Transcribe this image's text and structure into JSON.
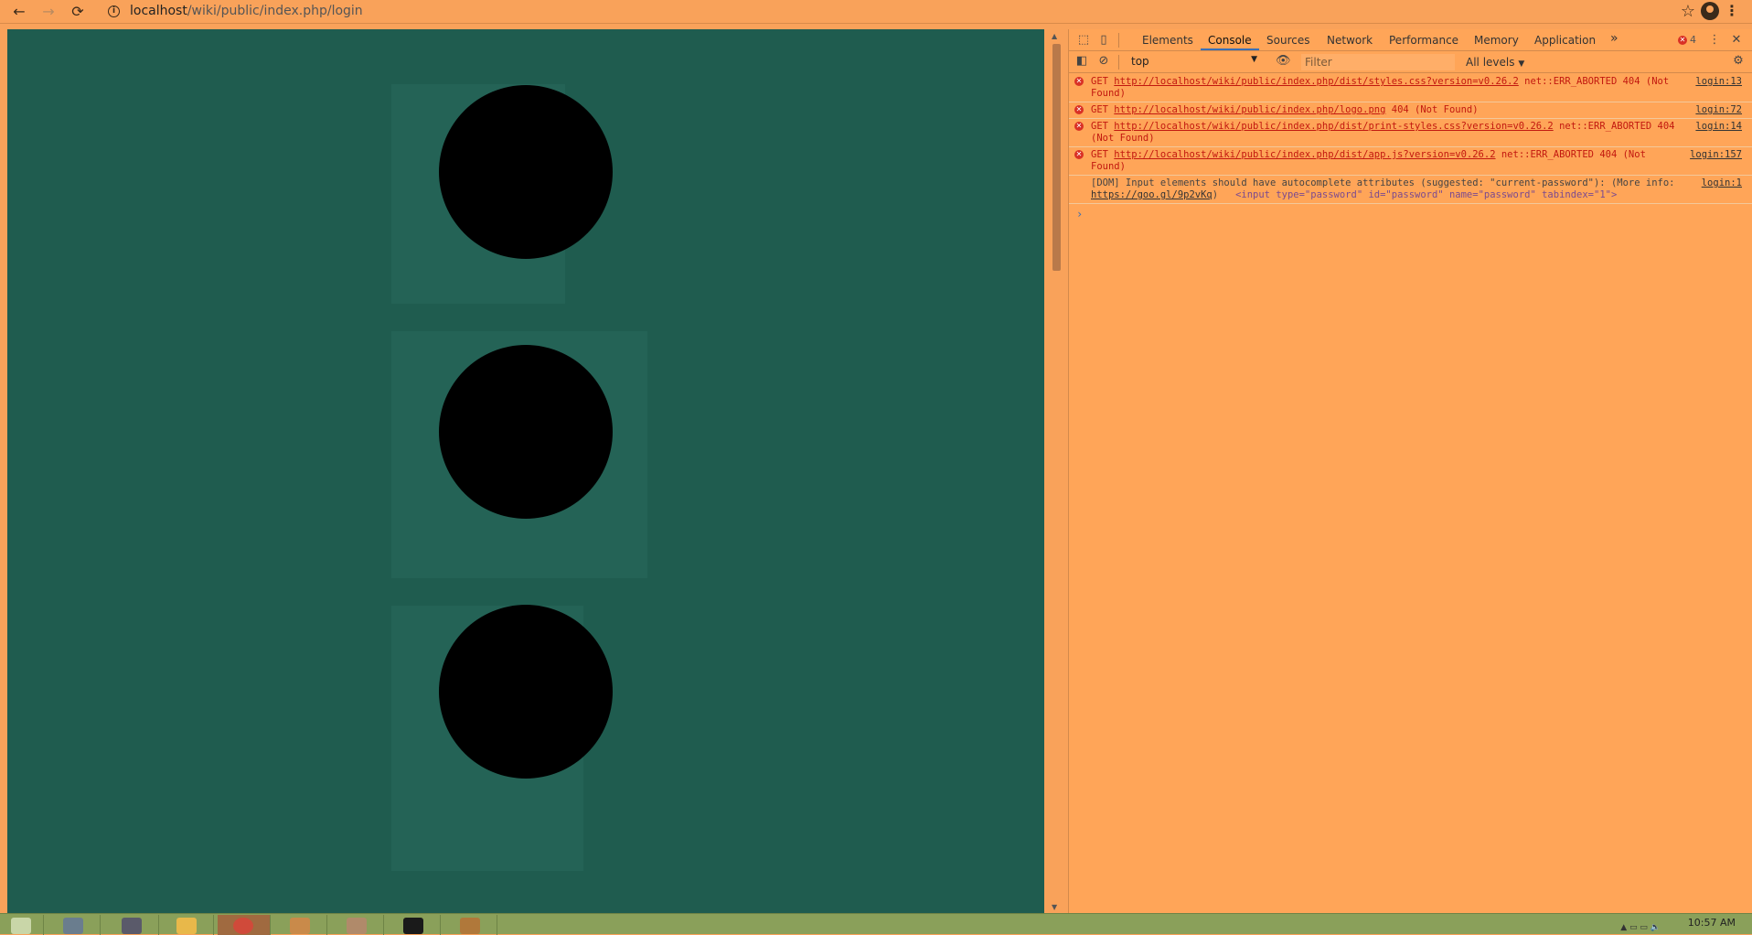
{
  "browser": {
    "url_host": "localhost",
    "url_path": "/wiki/public/index.php/login",
    "back_icon": "arrow-left-icon",
    "forward_icon": "arrow-right-icon",
    "reload_icon": "reload-icon"
  },
  "page": {
    "background": "#1f5c4f",
    "dot_color": "#000000",
    "dot_count": 3
  },
  "devtools": {
    "tabs": [
      "Elements",
      "Console",
      "Sources",
      "Network",
      "Performance",
      "Memory",
      "Application"
    ],
    "active_tab": "Console",
    "more_tabs": "»",
    "error_count": "4",
    "context": "top",
    "filter_placeholder": "Filter",
    "levels": "All levels",
    "messages": [
      {
        "level": "error",
        "method": "GET",
        "url": "http://localhost/wiki/public/index.php/dist/styles.css?version=v0.26.2",
        "tail": "net::ERR_ABORTED 404 (Not Found)",
        "source": "login:13"
      },
      {
        "level": "error",
        "method": "GET",
        "url": "http://localhost/wiki/public/index.php/logo.png",
        "tail": "404 (Not Found)",
        "source": "login:72"
      },
      {
        "level": "error",
        "method": "GET",
        "url": "http://localhost/wiki/public/index.php/dist/print-styles.css?version=v0.26.2",
        "tail": "net::ERR_ABORTED 404 (Not Found)",
        "source": "login:14"
      },
      {
        "level": "error",
        "method": "GET",
        "url": "http://localhost/wiki/public/index.php/dist/app.js?version=v0.26.2",
        "tail": "net::ERR_ABORTED 404 (Not Found)",
        "source": "login:157"
      },
      {
        "level": "info",
        "text": "[DOM] Input elements should have autocomplete attributes (suggested: \"current-password\"): (More info:",
        "link": "https://goo.gl/9p2vKq",
        "close": ")",
        "snippet": "<input type=\"password\" id=\"password\" name=\"password\" tabindex=\"1\">",
        "source": "login:1"
      }
    ],
    "prompt": "›"
  },
  "taskbar": {
    "clock": "10:57 AM"
  }
}
